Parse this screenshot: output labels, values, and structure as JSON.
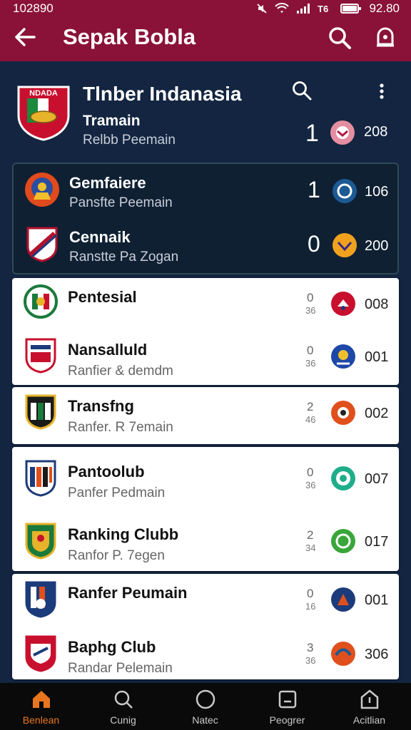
{
  "status_bar": {
    "time": "102890",
    "battery_text": "92.80"
  },
  "app_bar": {
    "title": "Sepak Bobla"
  },
  "header": {
    "title": "Tlnber Indanasia",
    "subtitle": "Tramain",
    "subtitle2": "Relbb Peemain",
    "rank": "1",
    "points": "208"
  },
  "featured": [
    {
      "name": "Gemfaiere",
      "sub": "Pansfte Peemain",
      "rank": "1",
      "points": "106"
    },
    {
      "name": "Cennaik",
      "sub": "Ranstte Pa Zogan",
      "rank": "0",
      "points": "200"
    }
  ],
  "list": [
    {
      "name": "Pentesial",
      "sub": "",
      "r1": "0",
      "r2": "36",
      "points": "008"
    },
    {
      "name": "Nansalluld",
      "sub": "Ranfier & demdm",
      "r1": "0",
      "r2": "36",
      "points": "001"
    },
    {
      "name": "Transfng",
      "sub": "Ranfer. R 7emain",
      "r1": "2",
      "r2": "46",
      "points": "002"
    },
    {
      "name": "Pantoolub",
      "sub": "Panfer Pedmain",
      "r1": "0",
      "r2": "36",
      "points": "007"
    },
    {
      "name": "Ranking Clubb",
      "sub": "Ranfor P. 7egen",
      "r1": "2",
      "r2": "34",
      "points": "017"
    },
    {
      "name": "Ranfer Peumain",
      "sub": "",
      "r1": "0",
      "r2": "16",
      "points": "001"
    },
    {
      "name": "Baphg Club",
      "sub": "Randar Pelemain",
      "r1": "3",
      "r2": "36",
      "points": "306"
    }
  ],
  "tabs": [
    {
      "label": "Benlean"
    },
    {
      "label": "Cunig"
    },
    {
      "label": "Natec"
    },
    {
      "label": "Peogrer"
    },
    {
      "label": "Acitlian"
    }
  ],
  "colors": {
    "primary": "#8a1239",
    "background": "#132540",
    "accent": "#e9761e"
  }
}
